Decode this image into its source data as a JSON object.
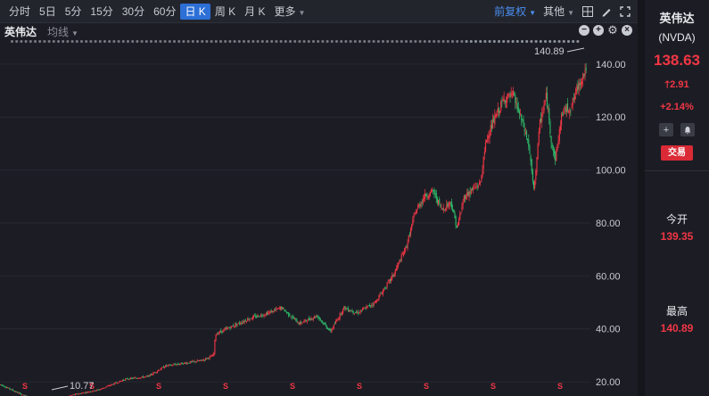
{
  "toolbar": {
    "timeframes": [
      "分时",
      "5日",
      "5分",
      "15分",
      "30分",
      "60分",
      "日 K",
      "周 K",
      "月 K",
      "更多"
    ],
    "active_index": 6,
    "adjust_label": "前复权",
    "other_label": "其他"
  },
  "chart_header": {
    "name": "英伟达",
    "indicator_label": "均线"
  },
  "panel": {
    "name": "英伟达",
    "code": "(NVDA)",
    "price": "138.63",
    "change": "2.91",
    "change_pct": "+2.14%",
    "trade_label": "交易",
    "open_label": "今开",
    "open_value": "139.35",
    "high_label": "最高",
    "high_value": "140.89"
  },
  "colors": {
    "background": "#1c1d24",
    "up": "#f23645",
    "down": "#2ebd6b",
    "accent": "#2c6fd6"
  },
  "chart_data": {
    "type": "candlestick",
    "y_ticks": [
      140,
      120,
      100,
      80,
      60,
      40,
      20
    ],
    "y_tick_labels": [
      "140.00",
      "120.00",
      "100.00",
      "80.00",
      "60.00",
      "40.00",
      "20.00"
    ],
    "ylim": [
      16,
      146
    ],
    "max_label": "140.89",
    "min_label": "10.77",
    "event_marker": "S",
    "keypoints": [
      [
        0,
        19
      ],
      [
        25,
        15
      ],
      [
        55,
        11
      ],
      [
        80,
        15
      ],
      [
        110,
        17
      ],
      [
        140,
        21
      ],
      [
        165,
        22
      ],
      [
        185,
        26
      ],
      [
        205,
        27
      ],
      [
        225,
        28
      ],
      [
        239,
        30
      ],
      [
        241,
        38
      ],
      [
        260,
        41
      ],
      [
        280,
        44
      ],
      [
        300,
        46
      ],
      [
        315,
        48
      ],
      [
        335,
        42
      ],
      [
        355,
        45
      ],
      [
        370,
        39
      ],
      [
        385,
        48
      ],
      [
        400,
        46
      ],
      [
        420,
        50
      ],
      [
        440,
        60
      ],
      [
        455,
        71
      ],
      [
        465,
        84
      ],
      [
        475,
        90
      ],
      [
        485,
        92
      ],
      [
        495,
        85
      ],
      [
        505,
        88
      ],
      [
        512,
        78
      ],
      [
        520,
        90
      ],
      [
        538,
        95
      ],
      [
        545,
        112
      ],
      [
        555,
        120
      ],
      [
        565,
        127
      ],
      [
        575,
        128
      ],
      [
        585,
        118
      ],
      [
        592,
        110
      ],
      [
        598,
        92
      ],
      [
        605,
        118
      ],
      [
        612,
        128
      ],
      [
        618,
        110
      ],
      [
        622,
        104
      ],
      [
        630,
        122
      ],
      [
        640,
        124
      ],
      [
        648,
        132
      ],
      [
        657,
        138.63
      ]
    ]
  }
}
